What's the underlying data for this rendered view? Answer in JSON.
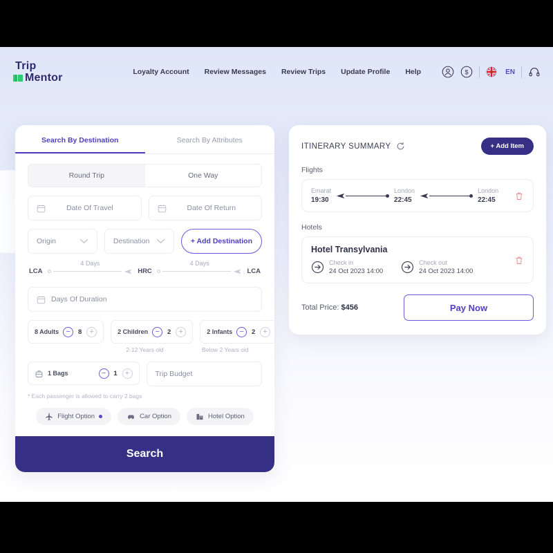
{
  "brand": {
    "line1": "Trip",
    "line2": "Mentor",
    "accent": "#2e2a6e",
    "green": "#2ecc71"
  },
  "nav": {
    "links": [
      {
        "label": "Loyalty Account"
      },
      {
        "label": "Review Messages"
      },
      {
        "label": "Review Trips"
      },
      {
        "label": "Update Profile"
      },
      {
        "label": "Help"
      }
    ],
    "language": "EN",
    "icons": [
      "user-circle-icon",
      "dollar-circle-icon",
      "uk-flag-icon",
      "headset-icon"
    ]
  },
  "search_panel": {
    "tabs": [
      {
        "label": "Search By Destination",
        "active": true
      },
      {
        "label": "Search By Attributes",
        "active": false
      }
    ],
    "trip_type": [
      {
        "label": "Round Trip",
        "active": true
      },
      {
        "label": "One Way",
        "active": false
      }
    ],
    "date_travel": {
      "placeholder": "Date Of Travel"
    },
    "date_return": {
      "placeholder": "Date Of Return"
    },
    "origin": {
      "placeholder": "Origin"
    },
    "destination": {
      "placeholder": "Destination"
    },
    "add_destination": "+ Add Destination",
    "route": {
      "stops": [
        "LCA",
        "HRC",
        "LCA"
      ],
      "legs": [
        "4 Days",
        "4 Days"
      ]
    },
    "days_duration": {
      "placeholder": "Days Of Duration"
    },
    "counters": [
      {
        "label": "8 Adults",
        "value": "8",
        "hint": ""
      },
      {
        "label": "2 Children",
        "value": "2",
        "hint": "2-12 Years old"
      },
      {
        "label": "2 Infants",
        "value": "2",
        "hint": "Below 2 Years old"
      }
    ],
    "bags": {
      "label": "1 Bags",
      "value": "1"
    },
    "budget": {
      "placeholder": "Trip Budget"
    },
    "note": "* Each passenger is allowed to carry 2 bags",
    "options": [
      {
        "label": "Flight Option",
        "icon": "plane-icon",
        "selected": true
      },
      {
        "label": "Car Option",
        "icon": "car-icon",
        "selected": false
      },
      {
        "label": "Hotel Option",
        "icon": "hotel-icon",
        "selected": false
      }
    ],
    "search_button": "Search",
    "search_button_color": "#353086"
  },
  "itinerary": {
    "title": "ITINERARY SUMMARY",
    "add_item": "+ Add Item",
    "flights_label": "Flights",
    "flight_points": [
      {
        "city": "Emarat",
        "time": "19:30"
      },
      {
        "city": "London",
        "time": "22:45"
      },
      {
        "city": "London",
        "time": "22:45"
      }
    ],
    "hotels_label": "Hotels",
    "hotel": {
      "name": "Hotel Transylvania",
      "check_in_label": "Check in",
      "check_in_value": "24 Oct 2023 14:00",
      "check_out_label": "Check out",
      "check_out_value": "24 Oct 2023 14:00"
    },
    "total_label": "Total Price:",
    "total_value": "$456",
    "pay_button": "Pay Now",
    "accent": "#4e3fc4"
  }
}
